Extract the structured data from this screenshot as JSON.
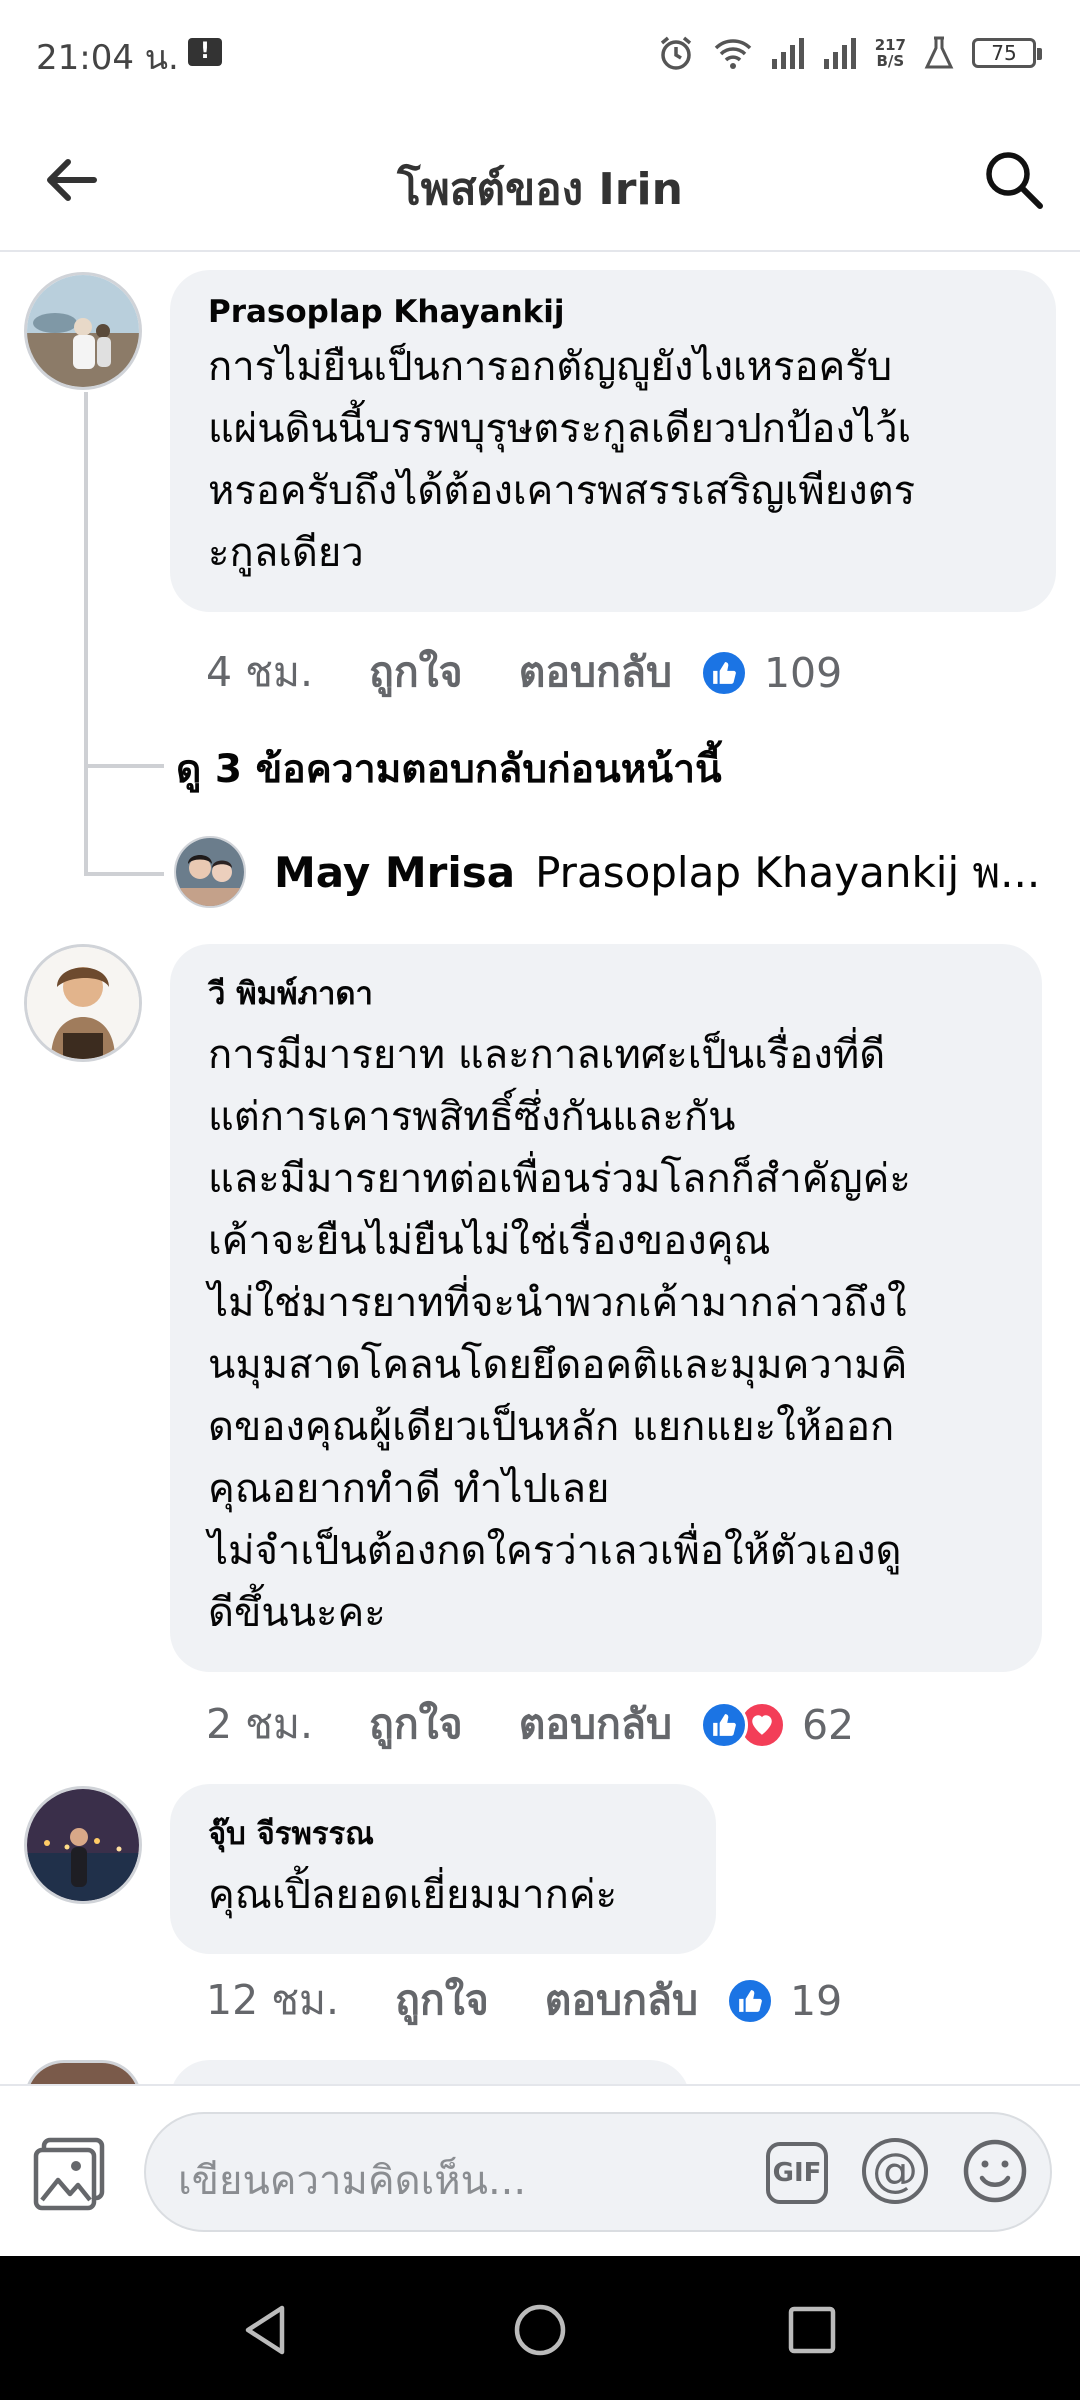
{
  "status_bar": {
    "time": "21:04 น.",
    "alert_icon": "alert-icon",
    "net_speed_value": "217",
    "net_speed_unit": "B/S",
    "battery": "75"
  },
  "header": {
    "title": "โพสต์ของ Irin",
    "back_icon": "arrow-left-icon",
    "search_icon": "search-icon"
  },
  "comments": [
    {
      "author": "Prasoplap Khayankij",
      "text": "การไม่ยืนเป็นการอกตัญญูยังไงเหรอครับ\nแผ่นดินนี้บรรพบุรุษตระกูลเดียวปกป้องไว้เ\nหรอครับถึงได้ต้องเคารพสรรเสริญเพียงตร\nะกูลเดียว",
      "time": "4 ชม.",
      "like_label": "ถูกใจ",
      "reply_label": "ตอบกลับ",
      "reaction_count": "109",
      "reactions": [
        "like"
      ]
    },
    {
      "author": "วี พิมพ์ภาดา",
      "text": "การมีมารยาท และกาลเทศะเป็นเรื่องที่ดี\nแต่การเคารพสิทธิ์ซึ่งกันและกัน\nและมีมารยาทต่อเพื่อนร่วมโลกก็สำคัญค่ะ\nเค้าจะยืนไม่ยืนไม่ใช่เรื่องของคุณ\nไม่ใช่มารยาทที่จะนำพวกเค้ามากล่าวถึงใ\nนมุมสาดโคลนโดยยึดอคติและมุมความคิ\nดของคุณผู้เดียวเป็นหลัก แยกแยะให้ออก\nคุณอยากทำดี ทำไปเลย\nไม่จำเป็นต้องกดใครว่าเลวเพื่อให้ตัวเองดู\nดีขึ้นนะคะ",
      "time": "2 ชม.",
      "like_label": "ถูกใจ",
      "reply_label": "ตอบกลับ",
      "reaction_count": "62",
      "reactions": [
        "like",
        "love"
      ]
    },
    {
      "author": "จุ๊บ จีรพรรณ",
      "text": "คุณเปิ้ลยอดเยี่ยมมากค่ะ",
      "time": "12 ชม.",
      "like_label": "ถูกใจ",
      "reply_label": "ตอบกลับ",
      "reaction_count": "19",
      "reactions": [
        "like"
      ]
    }
  ],
  "thread": {
    "view_previous": "ดู 3 ข้อความตอบกลับก่อนหน้านี้",
    "reply_author": "May Mrisa",
    "reply_preview": "Prasoplap Khayankij พ..."
  },
  "composer": {
    "placeholder": "เขียนความคิดเห็น...",
    "gif_label": "GIF",
    "mention_label": "@",
    "photo_icon": "photo-icon",
    "emoji_icon": "emoji-icon"
  },
  "colors": {
    "bubble": "#f0f2f5",
    "like_blue": "#1b74e4",
    "love_red": "#f33e58",
    "secondary_text": "#65676b"
  }
}
